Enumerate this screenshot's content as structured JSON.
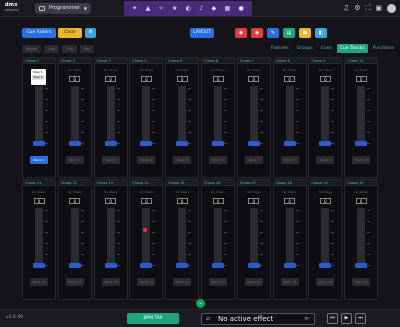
{
  "app": {
    "logo_top": "dmx",
    "logo_bottom": "DESKTOP",
    "mode": "Programmer"
  },
  "top_tools": [
    "bulb-icon",
    "cone-icon",
    "wand-icon",
    "star-icon",
    "palette-icon",
    "sound-icon",
    "dice-icon",
    "grid-icon",
    "people-icon"
  ],
  "top_right_icons": [
    "music-icon",
    "settings-icon",
    "fullscreen-icon",
    "folder-icon"
  ],
  "toolbar": {
    "cue_faders": "Cue Faders",
    "clear": "Clear",
    "layout": "LAYOUT"
  },
  "color_buttons": [
    {
      "name": "red-circle-button",
      "color": "#e23a3a",
      "glyph": "◉"
    },
    {
      "name": "red-stop-button",
      "color": "#e23a3a",
      "glyph": "◉"
    },
    {
      "name": "blue-action-button",
      "color": "#2a6ee0",
      "glyph": "✎"
    },
    {
      "name": "green-action-button",
      "color": "#1fa57d",
      "glyph": "▤"
    },
    {
      "name": "yellow-action-button",
      "color": "#e8b92e",
      "glyph": "◼"
    },
    {
      "name": "cyan-action-button",
      "color": "#38a4d8",
      "glyph": "◧"
    }
  ],
  "subrow": [
    "Modes",
    "Add",
    "Edit",
    "Del"
  ],
  "tabs": [
    {
      "label": "Fixtures",
      "active": false
    },
    {
      "label": "Groups",
      "active": false
    },
    {
      "label": "Cues",
      "active": false
    },
    {
      "label": "Cue Stacks",
      "active": true
    },
    {
      "label": "Functions",
      "active": false
    }
  ],
  "cue_stacks": [
    {
      "name": "Chase 1",
      "value": "0",
      "button": "Stack 1"
    },
    {
      "name": "Chase 2",
      "value": "0",
      "button": "Stack 2"
    },
    {
      "name": "Chase 3",
      "value": "0",
      "button": "Stack 3"
    },
    {
      "name": "Chase 4",
      "value": "0",
      "button": "Stack 4"
    },
    {
      "name": "Chase 5",
      "value": "0",
      "button": "Stack 5"
    },
    {
      "name": "Chase 6",
      "value": "0",
      "button": "Stack 6"
    },
    {
      "name": "Chase 7",
      "value": "0",
      "button": "Stack 7"
    },
    {
      "name": "Chase 8",
      "value": "0",
      "button": "Stack 8"
    },
    {
      "name": "Chase 9",
      "value": "0",
      "button": "Stack 9"
    },
    {
      "name": "Chase 10",
      "value": "0",
      "button": "Stack 10"
    },
    {
      "name": "Chase 11",
      "value": "0",
      "button": "Stack 11"
    },
    {
      "name": "Chase 12",
      "value": "0",
      "button": "Stack 12"
    },
    {
      "name": "Chase 13",
      "value": "0",
      "button": "Stack 13"
    },
    {
      "name": "Chase 14",
      "value": "0",
      "button": "Stack 14"
    },
    {
      "name": "Chase 15",
      "value": "0",
      "button": "Stack 15"
    },
    {
      "name": "Chase 16",
      "value": "0",
      "button": "Stack 16"
    },
    {
      "name": "Chase 17",
      "value": "0",
      "button": "Stack 17"
    },
    {
      "name": "Chase 18",
      "value": "0",
      "button": "Stack 18"
    },
    {
      "name": "Chase 19",
      "value": "0",
      "button": "Stack 19"
    },
    {
      "name": "Chase 20",
      "value": "0",
      "button": "Stack 20"
    }
  ],
  "step_label": "No Steps",
  "popup_items": [
    "Step 1",
    "Step 2"
  ],
  "status": {
    "version": "v1.0.49",
    "bpm_tap": "BPM TAP",
    "effect": "No active effect"
  }
}
